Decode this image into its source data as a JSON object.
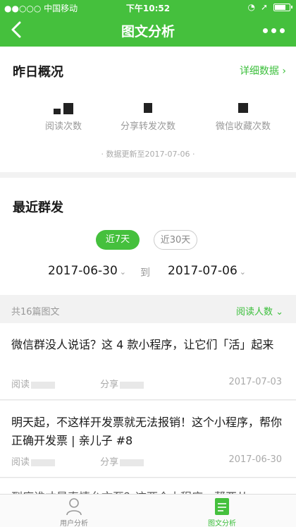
{
  "status_bar": {
    "carrier": "●●○○○ 中国移动",
    "time": "下午10:52"
  },
  "nav": {
    "title": "图文分析"
  },
  "overview": {
    "title": "昨日概况",
    "detail_link": "详细数据 ›",
    "stats": [
      {
        "label": "阅读次数"
      },
      {
        "label": "分享转发次数"
      },
      {
        "label": "微信收藏次数"
      }
    ],
    "update_note": "·  数据更新至2017-07-06  ·"
  },
  "recent": {
    "title": "最近群发",
    "range_options": [
      "近7天",
      "近30天"
    ],
    "active_range": "近7天",
    "start_date": "2017-06-30",
    "to_label": "到",
    "end_date": "2017-07-06"
  },
  "list_bar": {
    "count": "共16篇图文",
    "sort": "阅读人数 ⌄"
  },
  "articles": [
    {
      "title": "微信群没人说话？这 4 款小程序，让它们「活」起来",
      "read_label": "阅读",
      "share_label": "分享",
      "date": "2017-07-03"
    },
    {
      "title": "明天起，不这样开发票就无法报销！这个小程序，帮你正确开发票 | 亲儿子 #8",
      "read_label": "阅读",
      "share_label": "分享",
      "date": "2017-06-30"
    },
    {
      "title": "到底谁才是真情允文至？这两个小程序，帮亚从"
    }
  ],
  "tabbar": {
    "user_label": "用户分析",
    "article_label": "图文分析"
  },
  "colors": {
    "brand_green": "#45c03d",
    "link_green": "#3bbf3b"
  }
}
